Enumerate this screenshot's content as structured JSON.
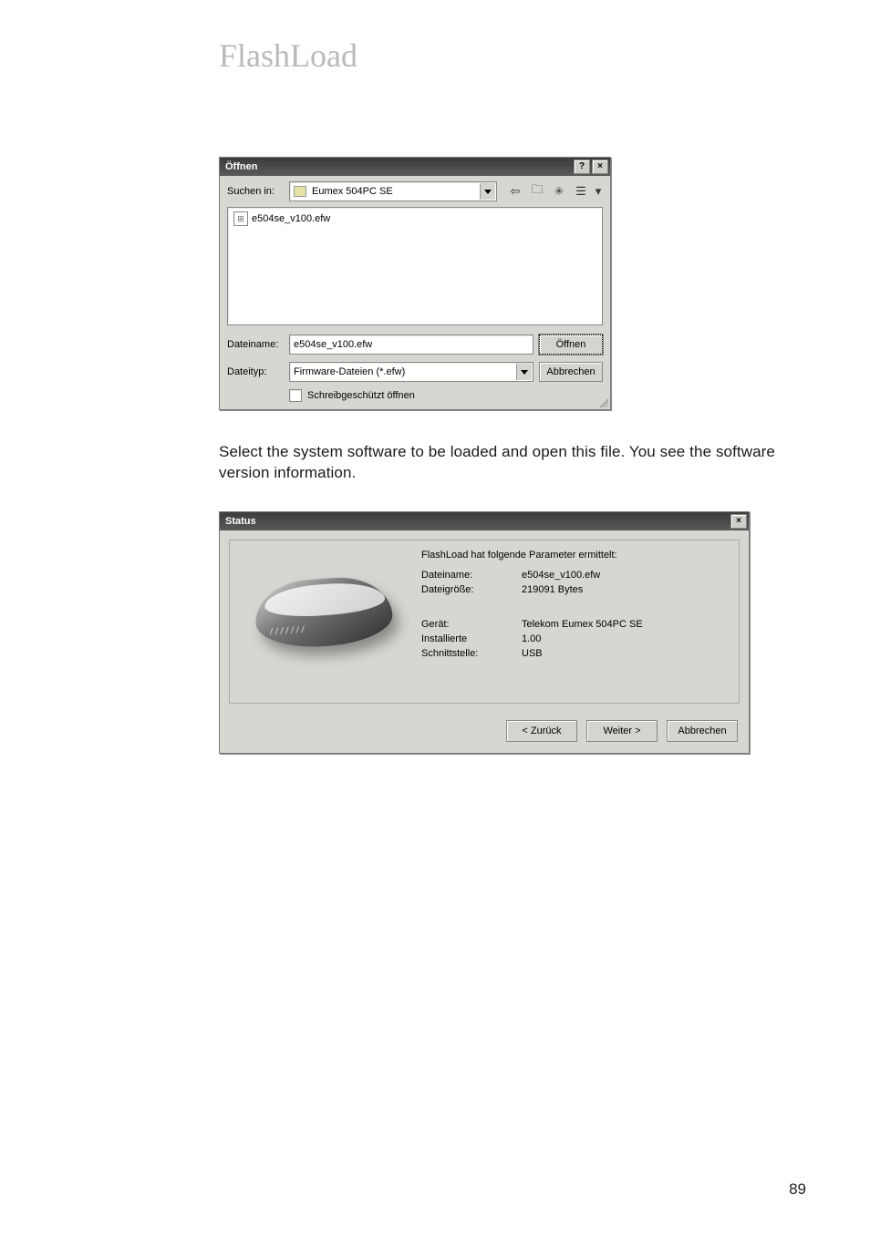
{
  "page": {
    "title": "FlashLoad",
    "body_text": "Select the system software to be loaded and open this file. You see the software version information.",
    "page_number": "89"
  },
  "open_dialog": {
    "title": "Öffnen",
    "help_glyph": "?",
    "close_glyph": "×",
    "search_in_label": "Suchen in:",
    "search_in_value": "Eumex 504PC SE",
    "nav": {
      "back_glyph": "⇦",
      "up_glyph": "🗀",
      "newfolder_glyph": "✳",
      "views_glyph": "☰",
      "views_dd_glyph": "▾"
    },
    "file_item": "e504se_v100.efw",
    "filename_label": "Dateiname:",
    "filename_value": "e504se_v100.efw",
    "filetype_label": "Dateityp:",
    "filetype_value": "Firmware-Dateien (*.efw)",
    "readonly_label": "Schreibgeschützt öffnen",
    "open_button": "Öffnen",
    "cancel_button": "Abbrechen"
  },
  "status_dialog": {
    "title": "Status",
    "close_glyph": "×",
    "heading": "FlashLoad hat folgende Parameter ermittelt:",
    "rows": {
      "filename_label": "Dateiname:",
      "filename_value": "e504se_v100.efw",
      "filesize_label": "Dateigröße:",
      "filesize_value": "219091 Bytes",
      "device_label": "Gerät:",
      "device_value": "Telekom Eumex 504PC SE",
      "installed_label": "Installierte",
      "installed_value": "1.00",
      "interface_label": "Schnittstelle:",
      "interface_value": "USB"
    },
    "buttons": {
      "back": "< Zurück",
      "next": "Weiter >",
      "cancel": "Abbrechen"
    }
  }
}
